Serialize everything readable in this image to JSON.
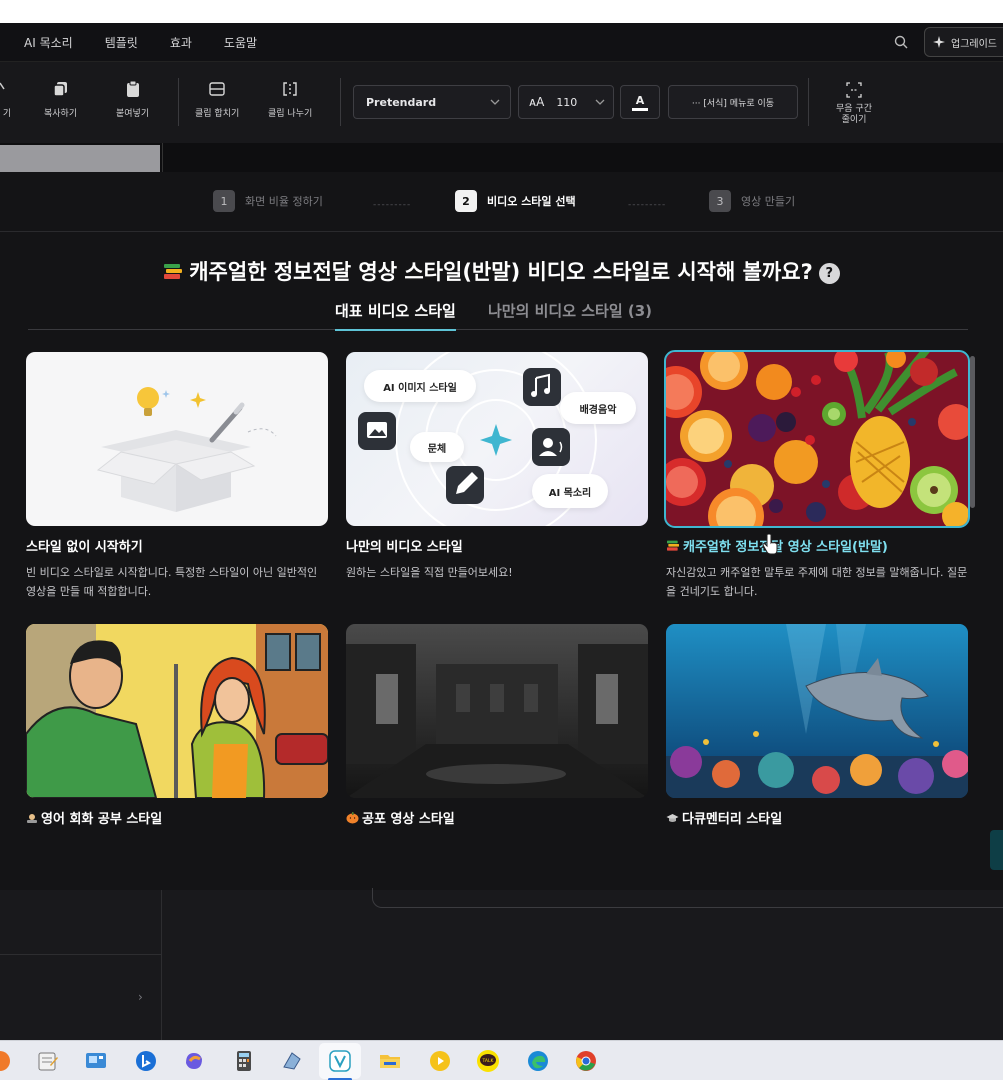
{
  "menu": {
    "items": [
      "AI 목소리",
      "템플릿",
      "효과",
      "도움말"
    ],
    "upgrade_label": "업그레이드"
  },
  "toolbar": {
    "copy": "복사하기",
    "paste": "붙여넣기",
    "merge": "클립 합치기",
    "split": "클립 나누기",
    "font": "Pretendard",
    "font_size_icon": "ᴀA",
    "font_size": "110",
    "color_label": "A",
    "format_menu": "··· [서식] 메뉴로 이동",
    "silence_line1": "무음 구간",
    "silence_line2": "줄이기",
    "left_cut": "기"
  },
  "steps": [
    {
      "num": "1",
      "label": "화면 비율 정하기",
      "state": "done"
    },
    {
      "num": "2",
      "label": "비디오 스타일 선택",
      "state": "current"
    },
    {
      "num": "3",
      "label": "영상 만들기",
      "state": "todo"
    }
  ],
  "step_dots": "---------",
  "headline": "캐주얼한 정보전달 영상 스타일(반말) 비디오 스타일로 시작해 볼까요?",
  "help_symbol": "?",
  "tabs": {
    "featured": "대표 비디오 스타일",
    "mine": "나만의 비디오 스타일 (3)"
  },
  "cards": [
    {
      "title": "스타일 없이 시작하기",
      "desc": "빈 비디오 스타일로 시작합니다. 특정한 스타일이 아닌 일반적인 영상을 만들 때 적합합니다."
    },
    {
      "title": "나만의 비디오 스타일",
      "desc": "원하는 스타일을 직접 만들어보세요!",
      "bubbles": {
        "ai_image": "AI 이미지 스타일",
        "music": "배경음악",
        "font": "문체",
        "voice": "AI 목소리"
      }
    },
    {
      "title": "캐주얼한 정보전달 영상 스타일(반말)",
      "desc": "자신감있고 캐주얼한 말투로 주제에 대한 정보를 말해줍니다. 질문을 건네기도 합니다.",
      "selected": true
    },
    {
      "title": "영어 회화 공부 스타일",
      "desc": ""
    },
    {
      "title": "공포 영상 스타일",
      "desc": ""
    },
    {
      "title": "다큐멘터리 스타일",
      "desc": ""
    }
  ],
  "icons": {
    "search": "search-icon",
    "sparkle": "sparkle-icon",
    "accent": "#3fb6d0"
  }
}
